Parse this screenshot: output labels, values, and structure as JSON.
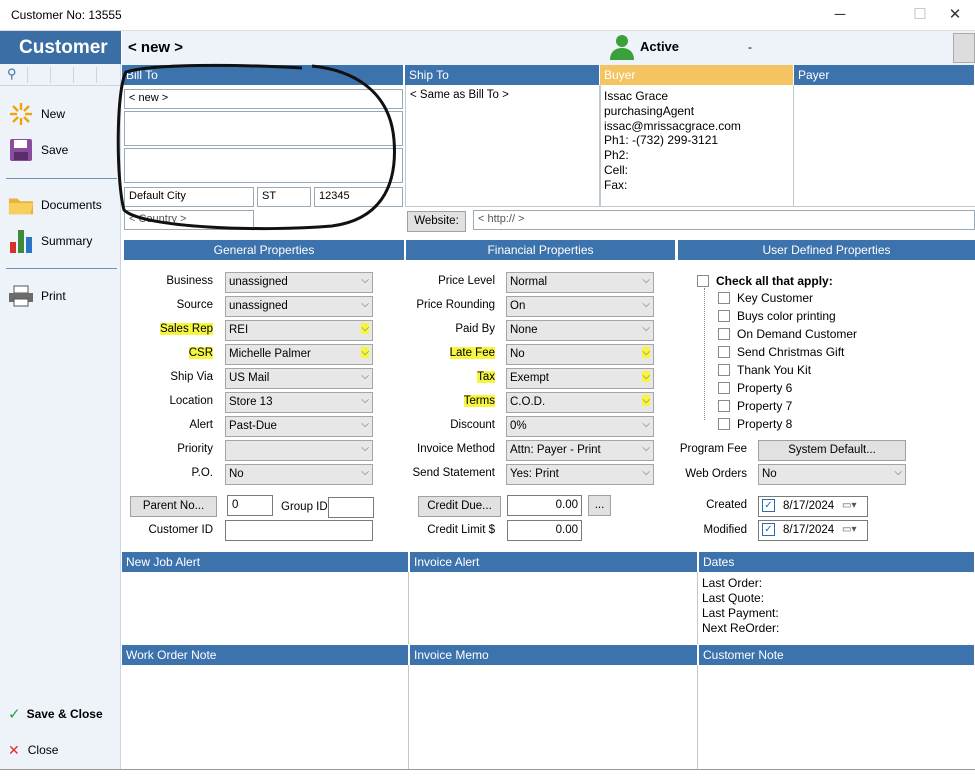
{
  "window": {
    "title": "Customer No: 13555",
    "minimize": "─",
    "maximize": "☐",
    "close": "✕"
  },
  "sidebar": {
    "brand": "Customer",
    "new_label": "New",
    "save_label": "Save",
    "documents_label": "Documents",
    "summary_label": "Summary",
    "print_label": "Print",
    "save_close_label": "Save & Close",
    "close_label": "Close"
  },
  "header": {
    "record_name": "< new >",
    "status": "Active",
    "status_extra": "-"
  },
  "sections": {
    "bill_to": "Bill To",
    "ship_to": "Ship To",
    "buyer": "Buyer",
    "payer": "Payer",
    "general": "General Properties",
    "financial": "Financial Properties",
    "user_defined": "User Defined Properties",
    "new_job_alert": "New Job Alert",
    "invoice_alert": "Invoice Alert",
    "dates": "Dates",
    "work_order_note": "Work Order Note",
    "invoice_memo": "Invoice Memo",
    "customer_note": "Customer Note"
  },
  "bill_to": {
    "name": "< new >",
    "line2": "",
    "line3": "",
    "city": "Default City",
    "state": "ST",
    "zip": "12345",
    "country": "< Country >"
  },
  "ship_to": {
    "text": "< Same as Bill To >"
  },
  "buyer": {
    "lines": [
      "Issac Grace",
      "purchasingAgent",
      "issac@mrissacgrace.com",
      "Ph1: -(732) 299-3121",
      "Ph2:",
      "Cell:",
      "Fax:"
    ]
  },
  "website": {
    "button": "Website:",
    "value": "< http:// >"
  },
  "general": {
    "labels": [
      "Business",
      "Source",
      "Sales Rep",
      "CSR",
      "Ship Via",
      "Location",
      "Alert",
      "Priority",
      "P.O."
    ],
    "values": [
      "unassigned",
      "unassigned",
      "REI",
      "Michelle Palmer",
      "US Mail",
      "Store 13",
      "Past-Due",
      "",
      "No"
    ],
    "parent_button": "Parent No...",
    "parent_value": "0",
    "group_label": "Group ID",
    "group_value": "",
    "customer_id_label": "Customer ID",
    "customer_id_value": ""
  },
  "financial": {
    "labels": [
      "Price Level",
      "Price Rounding",
      "Paid By",
      "Late Fee",
      "Tax",
      "Terms",
      "Discount",
      "Invoice Method",
      "Send Statement"
    ],
    "values": [
      "Normal",
      "On",
      "None",
      "No",
      "Exempt",
      "C.O.D.",
      "0%",
      "Attn: Payer - Print",
      "Yes: Print"
    ],
    "credit_due_button": "Credit Due...",
    "credit_due_value": "0.00",
    "ellipsis": "...",
    "credit_limit_label": "Credit Limit $",
    "credit_limit_value": "0.00"
  },
  "user_defined": {
    "check_all": "Check all that apply:",
    "items": [
      "Key Customer",
      "Buys color printing",
      "On Demand Customer",
      "Send Christmas Gift",
      "Thank You Kit",
      "Property 6",
      "Property 7",
      "Property 8"
    ],
    "program_fee_label": "Program Fee",
    "program_fee_button": "System Default...",
    "web_orders_label": "Web Orders",
    "web_orders_value": "No",
    "created_label": "Created",
    "created_value": "8/17/2024",
    "modified_label": "Modified",
    "modified_value": "8/17/2024"
  },
  "dates": {
    "lines": [
      "Last Order:",
      "Last Quote:",
      "Last Payment:",
      "Next ReOrder:"
    ]
  },
  "highlight_color": "#f5f542",
  "accent_color": "#3d73ad"
}
